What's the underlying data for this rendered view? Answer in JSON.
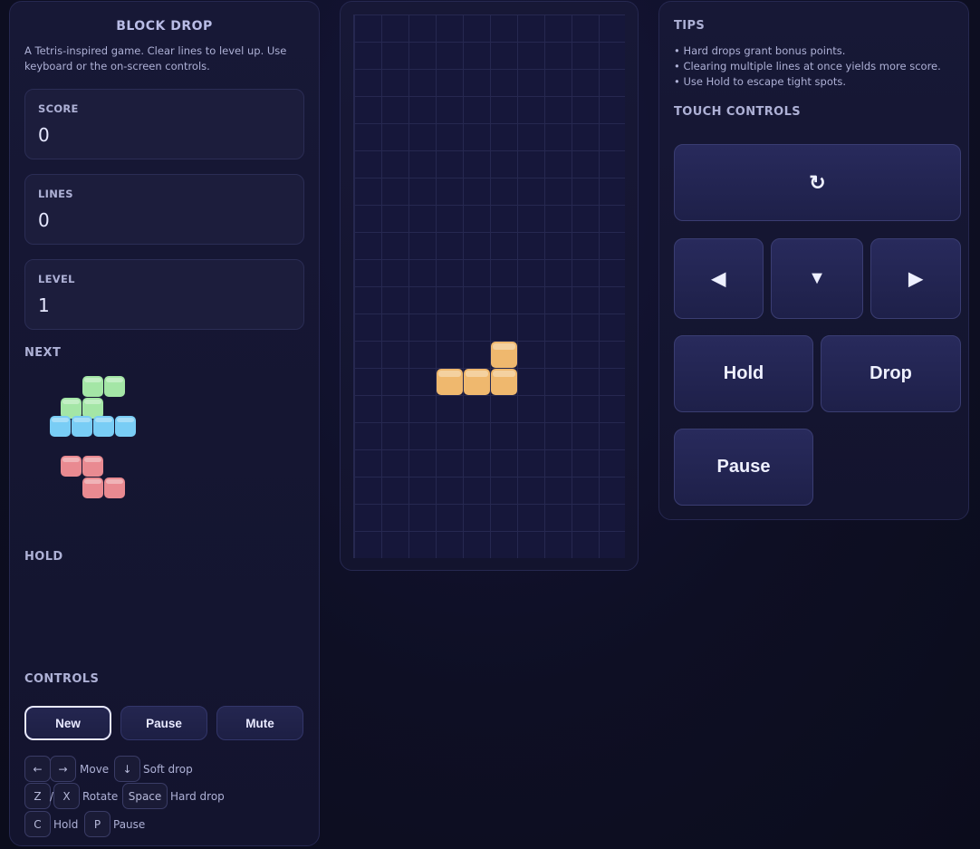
{
  "left": {
    "title": "BLOCK DROP",
    "description": "A Tetris-inspired game. Clear lines to level up. Use keyboard or the on-screen controls.",
    "stats": [
      {
        "label": "SCORE",
        "value": "0"
      },
      {
        "label": "LINES",
        "value": "0"
      },
      {
        "label": "LEVEL",
        "value": "1"
      }
    ],
    "next_heading": "NEXT",
    "next_pieces": [
      "S",
      "I",
      "Z"
    ],
    "hold_heading": "HOLD",
    "controls_heading": "CONTROLS",
    "buttons": {
      "new": "New",
      "pause": "Pause",
      "mute": "Mute"
    },
    "keys": {
      "left": "←",
      "right": "→",
      "move": "Move",
      "down": "↓",
      "soft_drop": "Soft drop",
      "z": "Z",
      "slash": "/",
      "x": "X",
      "rotate": "Rotate",
      "space": "Space",
      "hard_drop": "Hard drop",
      "c": "C",
      "hold": "Hold",
      "p": "P",
      "pause": "Pause"
    }
  },
  "board": {
    "columns": 10,
    "rows": 20,
    "active_piece": {
      "type": "L",
      "color": "#efb86e",
      "cells": [
        [
          5,
          12
        ],
        [
          3,
          13
        ],
        [
          4,
          13
        ],
        [
          5,
          13
        ]
      ]
    }
  },
  "right": {
    "tips_heading": "TIPS",
    "tips": [
      "• Hard drops grant bonus points.",
      "• Clearing multiple lines at once yields more score.",
      "• Use Hold to escape tight spots."
    ],
    "touch_heading": "TOUCH CONTROLS",
    "touch": {
      "rotate": "↻",
      "left": "◀",
      "down": "▼",
      "right": "▶",
      "hold": "Hold",
      "drop": "Drop",
      "pause": "Pause"
    }
  },
  "colors": {
    "green": "#a4e6a6",
    "cyan": "#79cdf5",
    "red": "#e98a91",
    "orange": "#efb86e"
  }
}
